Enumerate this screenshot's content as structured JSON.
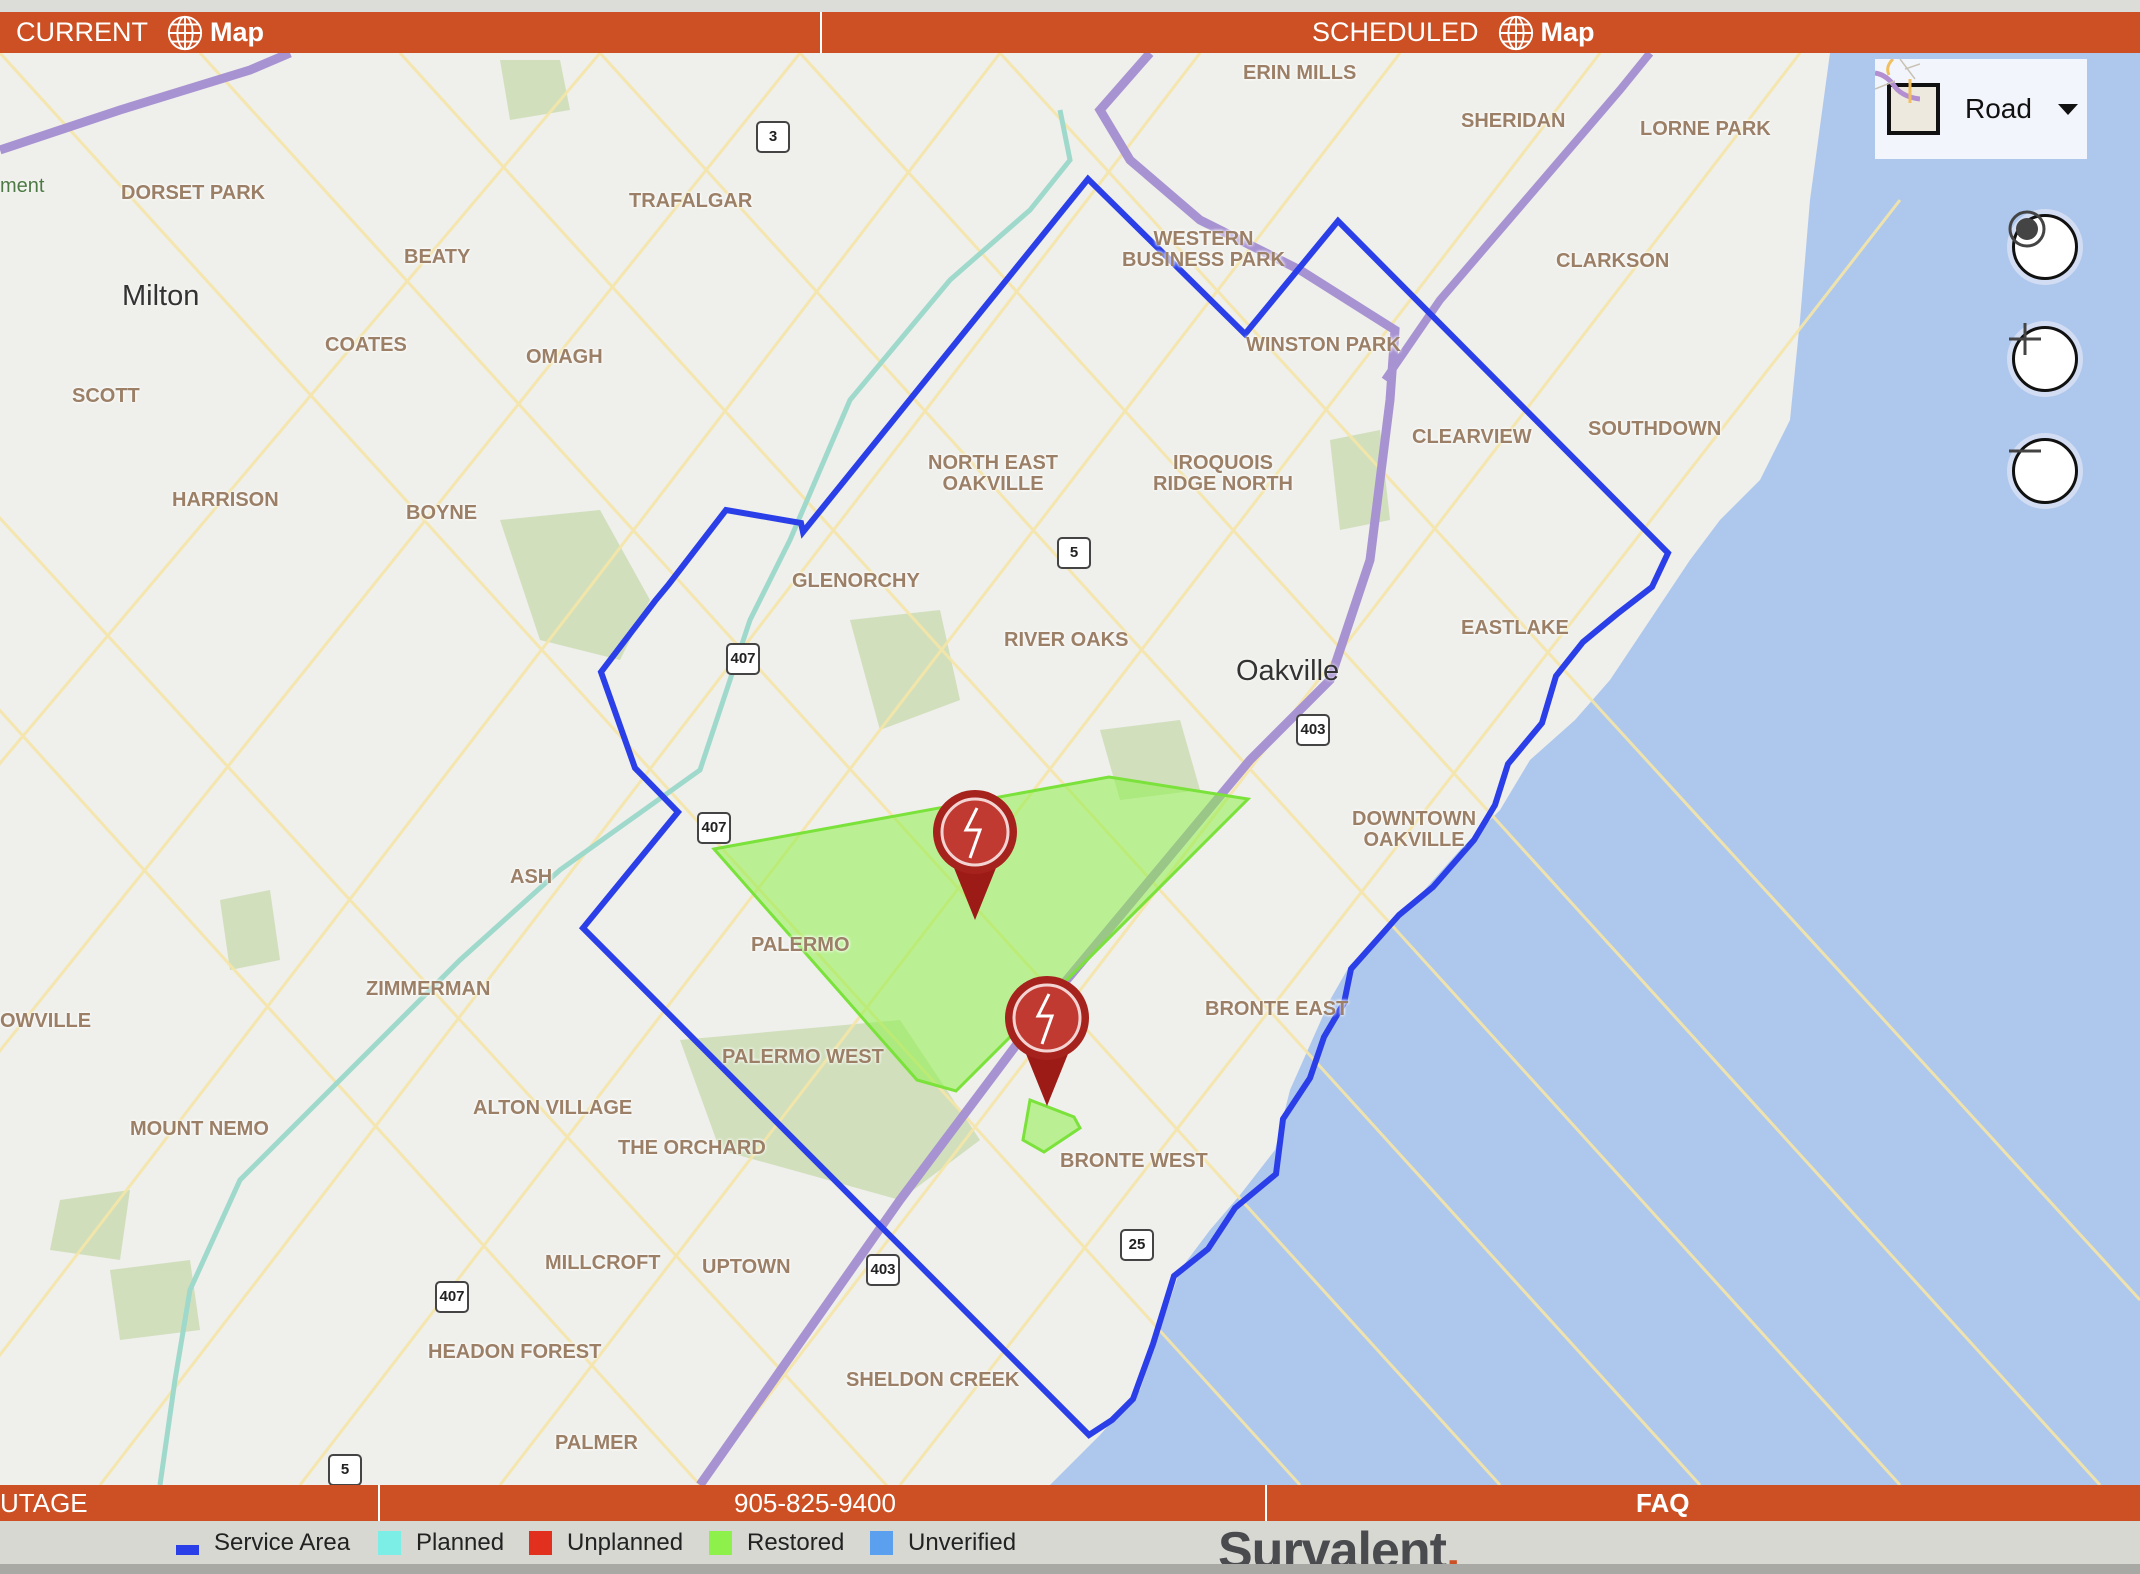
{
  "header": {
    "current": {
      "label": "CURRENT",
      "map_label": "Map"
    },
    "scheduled": {
      "label": "SCHEDULED",
      "map_label": "Map"
    }
  },
  "map": {
    "layer_selector": {
      "selected": "Road"
    },
    "controls": [
      "locate",
      "zoom-in",
      "zoom-out"
    ],
    "colors": {
      "service_area": "#2b3fe8",
      "restored_fill": "#8ef04a",
      "restored_stroke": "#7ae23a",
      "marker": "#9c1b17"
    },
    "outage_markers": [
      {
        "status": "Restored"
      },
      {
        "status": "Restored"
      }
    ],
    "place_labels": [
      {
        "text": "ERIN MILLS"
      },
      {
        "text": "SHERIDAN"
      },
      {
        "text": "LORNE PARK"
      },
      {
        "text": "DORSET PARK"
      },
      {
        "text": "TRAFALGAR"
      },
      {
        "text": "WESTERN\nBUSINESS PARK"
      },
      {
        "text": "CLARKSON"
      },
      {
        "text": "BEATY"
      },
      {
        "text": "COATES"
      },
      {
        "text": "OMAGH"
      },
      {
        "text": "WINSTON PARK"
      },
      {
        "text": "SCOTT"
      },
      {
        "text": "CLEARVIEW"
      },
      {
        "text": "SOUTHDOWN"
      },
      {
        "text": "NORTH EAST\nOAKVILLE"
      },
      {
        "text": "IROQUOIS\nRIDGE NORTH"
      },
      {
        "text": "HARRISON"
      },
      {
        "text": "BOYNE"
      },
      {
        "text": "GLENORCHY"
      },
      {
        "text": "RIVER OAKS"
      },
      {
        "text": "EASTLAKE"
      },
      {
        "text": "DOWNTOWN\nOAKVILLE"
      },
      {
        "text": "ASH"
      },
      {
        "text": "PALERMO"
      },
      {
        "text": "ZIMMERMAN"
      },
      {
        "text": "OWVILLE"
      },
      {
        "text": "BRONTE EAST"
      },
      {
        "text": "PALERMO WEST"
      },
      {
        "text": "MOUNT NEMO"
      },
      {
        "text": "ALTON VILLAGE"
      },
      {
        "text": "THE ORCHARD"
      },
      {
        "text": "BRONTE WEST"
      },
      {
        "text": "MILLCROFT"
      },
      {
        "text": "UPTOWN"
      },
      {
        "text": "HEADON FOREST"
      },
      {
        "text": "SHELDON CREEK"
      },
      {
        "text": "PALMER"
      }
    ],
    "cities": [
      {
        "text": "Milton"
      },
      {
        "text": "Oakville"
      }
    ],
    "edge_text": "ment",
    "highway_shields": [
      "3",
      "5",
      "407",
      "407",
      "403",
      "403",
      "25",
      "407",
      "5"
    ]
  },
  "footer": {
    "left": "UTAGE",
    "phone": "905-825-9400",
    "faq": "FAQ"
  },
  "legend": [
    {
      "label": "Service Area",
      "color": "#2b3fe8"
    },
    {
      "label": "Planned",
      "color": "#7deee6"
    },
    {
      "label": "Unplanned",
      "color": "#e2301f"
    },
    {
      "label": "Restored",
      "color": "#8ef04a"
    },
    {
      "label": "Unverified",
      "color": "#5aa0ee"
    }
  ],
  "brand": {
    "name": "Survalent",
    "dot": "."
  }
}
